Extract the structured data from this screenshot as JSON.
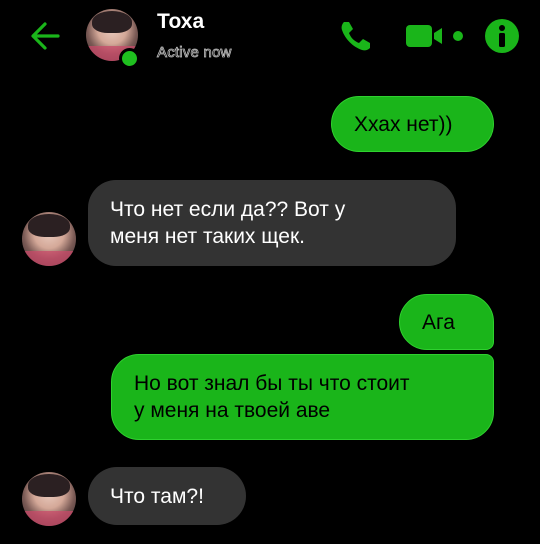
{
  "header": {
    "contact_name": "Тоха",
    "status": "Active now",
    "icons": {
      "back": "arrow-left-icon",
      "call": "phone-icon",
      "video": "video-camera-icon",
      "info": "info-icon"
    },
    "accent_color": "#1ab51a"
  },
  "messages": [
    {
      "direction": "outgoing",
      "text": "Ххах нет))"
    },
    {
      "direction": "incoming",
      "line1": "Что нет если да?? Вот у",
      "line2": "меня нет таких щек."
    },
    {
      "direction": "outgoing",
      "text": "Ага"
    },
    {
      "direction": "outgoing",
      "line1": "Но вот знал бы ты что стоит",
      "line2": "у меня на твоей аве"
    },
    {
      "direction": "incoming",
      "text": "Что там?!"
    }
  ],
  "colors": {
    "background": "#000000",
    "outgoing_bubble": "#1ab51a",
    "incoming_bubble": "#333333",
    "online": "#1fbf1f"
  }
}
